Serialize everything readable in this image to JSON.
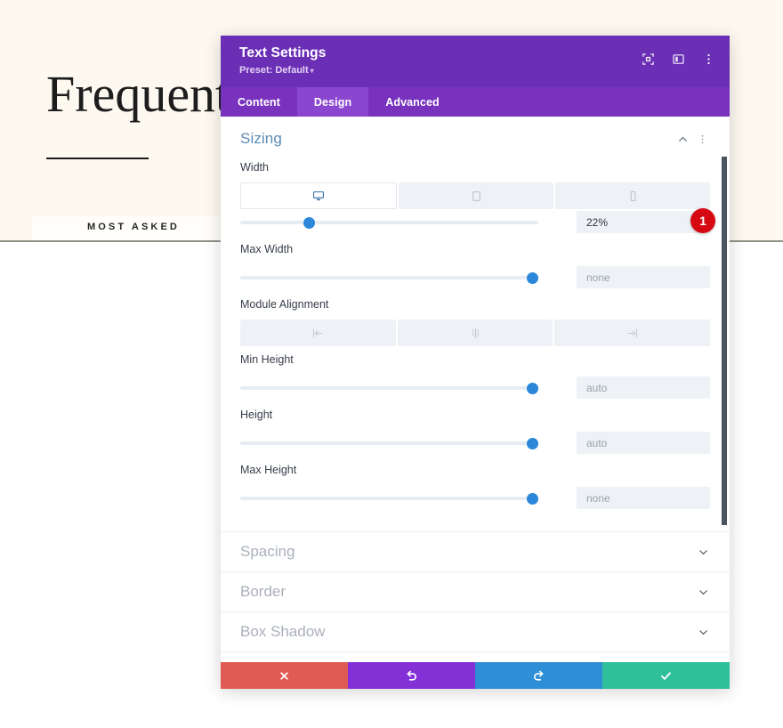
{
  "background": {
    "hero_title": "Frequently",
    "eyebrow": "MOST ASKED",
    "bg_color": "#fdf9f0"
  },
  "modal": {
    "title": "Text Settings",
    "preset_label": "Preset: Default",
    "preset_caret": "▾",
    "header_icons": [
      {
        "name": "focus-icon",
        "label": "Focus"
      },
      {
        "name": "layout-panel-icon",
        "label": "Layout"
      },
      {
        "name": "more-vertical-icon",
        "label": "More options"
      }
    ],
    "tabs": [
      {
        "label": "Content",
        "active": false
      },
      {
        "label": "Design",
        "active": true
      },
      {
        "label": "Advanced",
        "active": false
      }
    ],
    "sizing": {
      "title": "Sizing",
      "collapse_icon": "chevron-up-icon",
      "menu_icon": "more-vertical-icon",
      "width": {
        "label": "Width",
        "devices": [
          {
            "name": "desktop",
            "active": true
          },
          {
            "name": "tablet",
            "active": false
          },
          {
            "name": "phone",
            "active": false
          }
        ],
        "value": "22%",
        "slider_percent": 23
      },
      "max_width": {
        "label": "Max Width",
        "value": "",
        "placeholder": "none",
        "slider_percent": 98
      },
      "module_alignment": {
        "label": "Module Alignment",
        "options": [
          {
            "name": "align-left",
            "active": false
          },
          {
            "name": "align-center",
            "active": false
          },
          {
            "name": "align-right",
            "active": false
          }
        ]
      },
      "min_height": {
        "label": "Min Height",
        "value": "",
        "placeholder": "auto",
        "slider_percent": 98
      },
      "height": {
        "label": "Height",
        "value": "",
        "placeholder": "auto",
        "slider_percent": 98
      },
      "max_height": {
        "label": "Max Height",
        "value": "",
        "placeholder": "none",
        "slider_percent": 98
      }
    },
    "collapsed_sections": [
      {
        "label": "Spacing"
      },
      {
        "label": "Border"
      },
      {
        "label": "Box Shadow"
      }
    ],
    "footer": [
      {
        "name": "close-button",
        "icon": "x-icon",
        "color": "#e15b55"
      },
      {
        "name": "undo-button",
        "icon": "undo-icon",
        "color": "#8331d6"
      },
      {
        "name": "redo-button",
        "icon": "redo-icon",
        "color": "#2e8fd6"
      },
      {
        "name": "save-button",
        "icon": "check-icon",
        "color": "#2ebf9b"
      }
    ]
  },
  "annotation": {
    "badge_number": "1",
    "badge_color": "#d60812"
  }
}
